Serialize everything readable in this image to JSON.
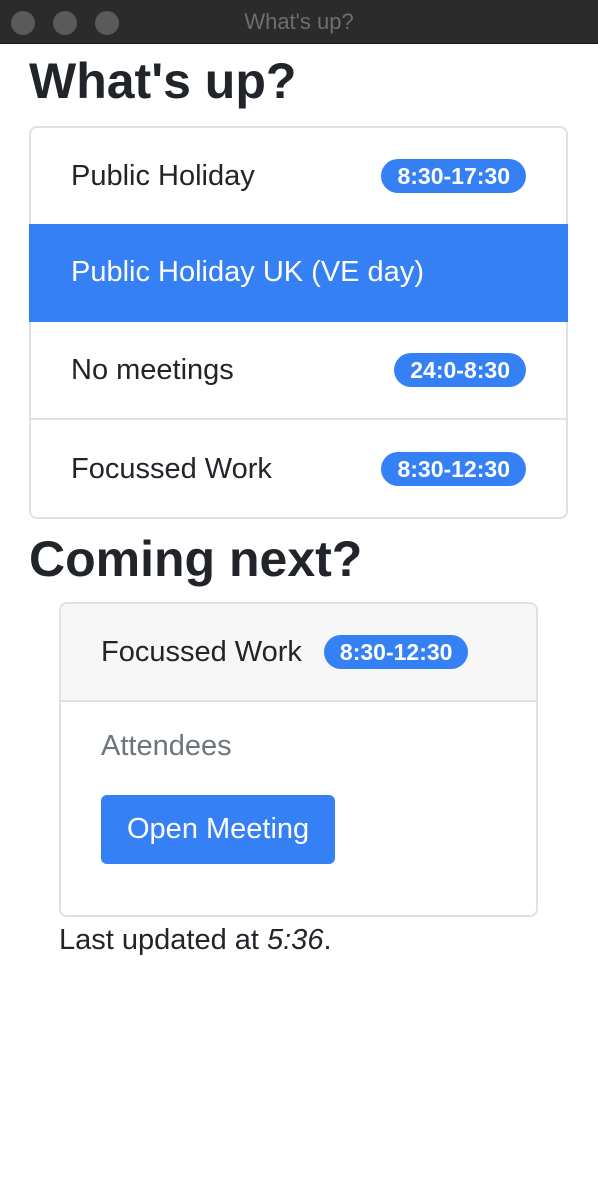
{
  "window": {
    "title": "What's up?"
  },
  "now": {
    "heading": "What's up?",
    "items": [
      {
        "title": "Public Holiday",
        "time": "8:30-17:30",
        "active": false
      },
      {
        "title": "Public Holiday UK (VE day)",
        "time": "",
        "active": true
      },
      {
        "title": "No meetings",
        "time": "24:0-8:30",
        "active": false
      },
      {
        "title": "Focussed Work",
        "time": "8:30-12:30",
        "active": false
      }
    ]
  },
  "next": {
    "heading": "Coming next?",
    "title": "Focussed Work",
    "time": "8:30-12:30",
    "attendees_label": "Attendees",
    "open_button": "Open Meeting"
  },
  "footer": {
    "prefix": "Last updated at ",
    "time": "5:36",
    "suffix": "."
  },
  "colors": {
    "accent": "#3480f4",
    "muted": "#6c757d",
    "titlebar": "#2b2b2b"
  }
}
